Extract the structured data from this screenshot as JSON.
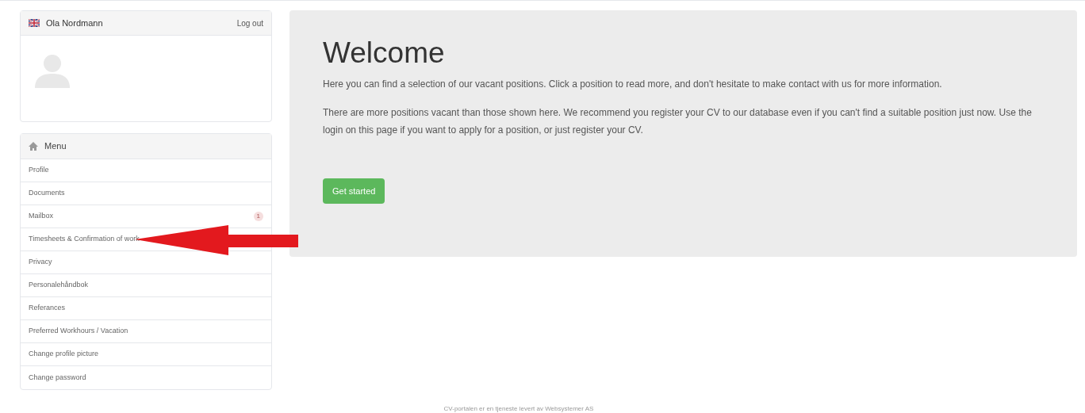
{
  "user": {
    "name": "Ola Nordmann",
    "logout": "Log out"
  },
  "menu": {
    "title": "Menu",
    "items": [
      {
        "label": "Profile"
      },
      {
        "label": "Documents"
      },
      {
        "label": "Mailbox",
        "badge": "1"
      },
      {
        "label": "Timesheets & Confirmation of work"
      },
      {
        "label": "Privacy"
      },
      {
        "label": "Personalehåndbok"
      },
      {
        "label": "Referances"
      },
      {
        "label": "Preferred Workhours / Vacation"
      },
      {
        "label": "Change profile picture"
      },
      {
        "label": "Change password"
      }
    ]
  },
  "hero": {
    "title": "Welcome",
    "paragraphs": [
      "Here you can find a selection of our vacant positions. Click a position to read more, and don't hesitate to make contact with us for more information.",
      "There are more positions vacant than those shown here. We recommend you register your CV to our database even if you can't find a suitable position just now. Use the login on this page if you want to apply for a position, or just register your CV."
    ],
    "button": "Get started"
  },
  "footer": "CV-portalen er en tjeneste levert av Websystemer AS"
}
